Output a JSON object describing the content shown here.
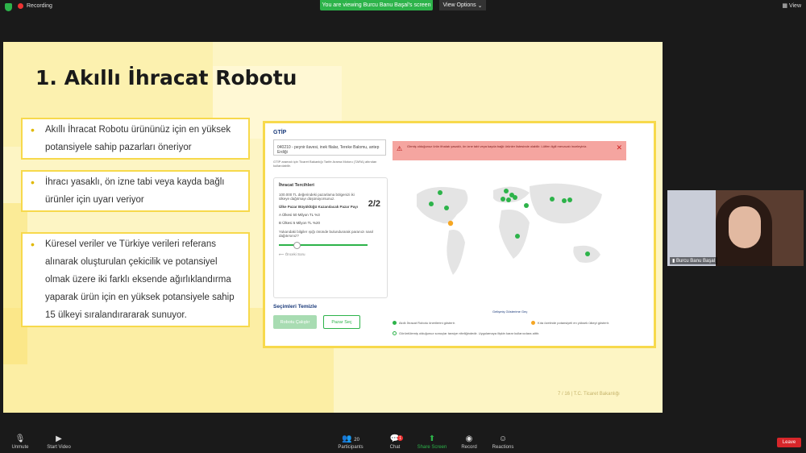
{
  "topbar": {
    "recording": "Recording",
    "viewing": "You are viewing Burcu Banu Başal's screen",
    "view_options": "View Options",
    "view": "View"
  },
  "slide": {
    "title": "1. Akıllı İhracat Robotu",
    "bullets": [
      "Akıllı İhracat Robotu ürününüz için en yüksek potansiyele sahip pazarları öneriyor",
      "İhracı yasaklı, ön izne tabi veya kayda bağlı ürünler için uyarı veriyor",
      "Küresel veriler ve Türkiye verileri referans alınarak oluşturulan çekicilik ve potansiyel olmak üzere iki farklı eksende ağırlıklandırma yaparak ürün için en yüksek potansiyele sahip 15 ülkeyi sıralandırararak sunuyor."
    ],
    "page_number": "7 / 16 | T.C. Ticaret Bakanlığı"
  },
  "app": {
    "gtip_label": "GTİP",
    "gtip_value": "040210 - peynir ilavesi, inek filalar, Tereke Balomu, antep Erdiği",
    "note": "GTİP aramalı için Ticaret Bakanlığı Tarife Arama Motoru (TARA) altından kullanılabilir.",
    "card_title": "İhracat Tercihleri",
    "card_text": "100.000 TL değerindeki pazarlama bölgenizi iki ülkeye dağıtmayı düşünüyorsunuz.",
    "page": "2/2",
    "headers": "Ülke    Pazar Büyüklüğü    Kazanılacak Pazar Payı",
    "row1": "A Ülkesi    50 Milyon TL    %3",
    "row2": "B Ülkesi    5 Milyon TL    %20",
    "question": "Yukarıdaki bilgiler ışığı önünde bulundurarak paranızı nasıl dağıtırsınız?",
    "back": "Önceki Soru",
    "clear": "Seçimleri Temizle",
    "btn_run": "Robotu Çalıştır",
    "btn_select": "Pazar Seç",
    "alert": "Girmiş olduğunuz ürün ithalatı yasaklı, ön izne tabi veya kayda bağlı ürünler listesinde olabilir. Lütfen ilgili mevzuatı inceleyiniz.",
    "legend_title": "Gelişmiş Gösterime Geç",
    "legend_green": "Akıllı İhracat Robotu önerilerini gösterir.",
    "legend_orange": "Kıta özelinde potansiyeli en yüksek ülkeyi gösterir.",
    "legend_info": "Görüntülemiş olduğunuz sonuçlar tavsiye niteliğindedir. Uygulamaya ilişkin karar kullanıcılara aittir."
  },
  "camera": {
    "name": "Burcu Banu Başal"
  },
  "bottombar": {
    "unmute": "Unmute",
    "start_video": "Start Video",
    "participants": "Participants",
    "participants_count": "20",
    "chat": "Chat",
    "chat_badge": "1",
    "share_screen": "Share Screen",
    "record": "Record",
    "reactions": "Reactions",
    "leave": "Leave"
  },
  "colors": {
    "accent_green": "#2db34a",
    "leave_red": "#d7262a",
    "slide_yellow": "#fdf5c4"
  }
}
